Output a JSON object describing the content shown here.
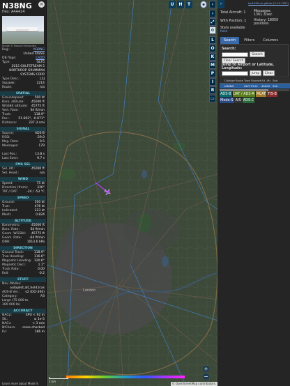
{
  "aircraft": {
    "callsign": "N38NG",
    "hex_label": "Hex: A4A424",
    "photo_credit": "Image © Manuel Fernandes",
    "registration_label": "Reg.:",
    "registration": "N38NG",
    "country": "United States",
    "db_flags_label": "DB flags:",
    "db_flags": "LADD",
    "type_label": "Type:",
    "type": "GLF5",
    "type_desc_1": "2015 GULFSTREAM 5",
    "type_desc_2": "NORTHROP GRUMMAN",
    "type_desc_3": "SYSTEMS CORP",
    "typedesc_label": "Type Desc.:",
    "typedesc": "L2J",
    "squawk_label": "Squawk:",
    "squawk": "2214",
    "route_label": "Route:",
    "route": "n/a"
  },
  "sections": [
    {
      "title": "SPATIAL",
      "rows": [
        {
          "k": "Groundspeed:",
          "v": "500 kt"
        },
        {
          "k": "Baro. altitude:",
          "v": "45000 ft"
        },
        {
          "k": "WGS84 altitude:",
          "v": "45775 ft"
        },
        {
          "k": "Vert. Rate:",
          "v": "64 ft/min"
        },
        {
          "k": "Track:",
          "v": "118.9°"
        },
        {
          "k": "Pos.:",
          "v": "51.662°, -0.071°"
        },
        {
          "k": "Distance:",
          "v": "237.3 nmi"
        }
      ]
    },
    {
      "title": "SIGNAL",
      "rows": [
        {
          "k": "Source:",
          "v": "ADS-B"
        },
        {
          "k": "RSSI:",
          "v": "-29.0"
        },
        {
          "k": "Msg. Rate:",
          "v": "0.5"
        },
        {
          "k": "Messages:",
          "v": "179"
        },
        {
          "k": "",
          "v": ""
        },
        {
          "k": "Last Pos.:",
          "v": "13.8 s"
        },
        {
          "k": "Last Seen:",
          "v": "9.7 s"
        }
      ]
    },
    {
      "title": "FMS SEL",
      "rows": [
        {
          "k": "Sel. Alt.:",
          "v": "45000 ft"
        },
        {
          "k": "Sel. Head.:",
          "v": "n/a"
        }
      ]
    },
    {
      "title": "WIND",
      "rows": [
        {
          "k": "Speed:",
          "v": "75 kt"
        },
        {
          "k": "Direction (from):",
          "v": "336°"
        },
        {
          "k": "TAT / OAT:",
          "v": "-24 / -53 °C"
        }
      ]
    },
    {
      "title": "SPEED",
      "rows": [
        {
          "k": "Ground:",
          "v": "500 kt"
        },
        {
          "k": "True:",
          "v": "476 kt"
        },
        {
          "k": "Indicated:",
          "v": "223 kt"
        },
        {
          "k": "Mach:",
          "v": "0.824"
        }
      ]
    },
    {
      "title": "ALTITUDE",
      "rows": [
        {
          "k": "Barometric:",
          "v": "45000 ft"
        },
        {
          "k": "Baro. Rate:",
          "v": "64 ft/min"
        },
        {
          "k": "Geom. WGS84:",
          "v": "45775 ft"
        },
        {
          "k": "Geom. Rate:",
          "v": "-64 ft/min"
        },
        {
          "k": "QNH:",
          "v": "1013.6 hPa"
        }
      ]
    },
    {
      "title": "DIRECTION",
      "rows": [
        {
          "k": "Ground Track:",
          "v": "118.9°"
        },
        {
          "k": "True Heading:",
          "v": "116.6°"
        },
        {
          "k": "Magnetic Heading:",
          "v": "120.6°"
        },
        {
          "k": "Magnetic Decl.:",
          "v": "1.1°"
        },
        {
          "k": "Track Rate:",
          "v": "0.00"
        },
        {
          "k": "Roll:",
          "v": "-0.2"
        }
      ]
    },
    {
      "title": "STUFF",
      "rows": [
        {
          "k": "Nav. Modes:",
          "v": ""
        },
        {
          "k": "",
          "v": "autopilot,alt_hold,tcas"
        },
        {
          "k": "ADS-B Ver.:",
          "v": "v2 (DO-260)"
        },
        {
          "k": "Category:",
          "v": "A3"
        },
        {
          "k": "Large (75 000 to",
          "v": ""
        },
        {
          "k": "300 000 lb)",
          "v": ""
        }
      ]
    },
    {
      "title": "ACCURACY",
      "rows": [
        {
          "k": "NACp:",
          "v": "EPU < 92 m"
        },
        {
          "k": "SIL:",
          "v": "≤ 1e-5"
        },
        {
          "k": "NACv:",
          "v": "< 3 m/s"
        },
        {
          "k": "NICbaro:",
          "v": "cross-checked"
        },
        {
          "k": "Rc:",
          "v": "186 m"
        }
      ]
    }
  ],
  "footer": "Learn more about Mode S",
  "map": {
    "top_buttons": [
      "U",
      "H",
      "T"
    ],
    "side_buttons": [
      "L",
      "O",
      "K",
      "M",
      "P",
      "I",
      "R"
    ],
    "scale_label": "1 km",
    "attribution": "© OpenStreetMap contributors.",
    "labels": [
      "London"
    ]
  },
  "right": {
    "github": "tar1090 on github (3.14.1767)",
    "total_aircraft": "Total Aircraft: 1",
    "with_position": "With Position: 1",
    "messages": "Messages: 1361.3/sec",
    "history": "History: 18050 positions",
    "stats_label": "Stats available",
    "stats_link": "here",
    "tabs": [
      "Search",
      "Filters",
      "Columns"
    ],
    "search_label": "Search:",
    "search_button": "Search",
    "clear_search": "Clear Search",
    "jump_label": "Jump to Airport or Latitude, Longitude:",
    "jump_button": "Jump",
    "clear_button": "Clear",
    "columns": [
      "",
      "Callsign",
      "Route",
      "Type",
      "Squawk",
      "Alt. (ft)",
      "Spd"
    ],
    "row": [
      "",
      "N38NG",
      "",
      "GLF5",
      "2214",
      "45000",
      "500"
    ],
    "sources": [
      {
        "label": "ADS-B",
        "color": "#0a6a6a"
      },
      {
        "label": "UAT / ADS-R",
        "color": "#5a7b1a"
      },
      {
        "label": "MLAT",
        "color": "#a07c2a"
      },
      {
        "label": "TIS-B",
        "color": "#8a2a2a"
      },
      {
        "label": "Mode-S",
        "color": "#2a4a8a"
      },
      {
        "label": "AIS",
        "color": "#333333"
      },
      {
        "label": "ADS-C",
        "color": "#2a6a3a"
      }
    ]
  }
}
